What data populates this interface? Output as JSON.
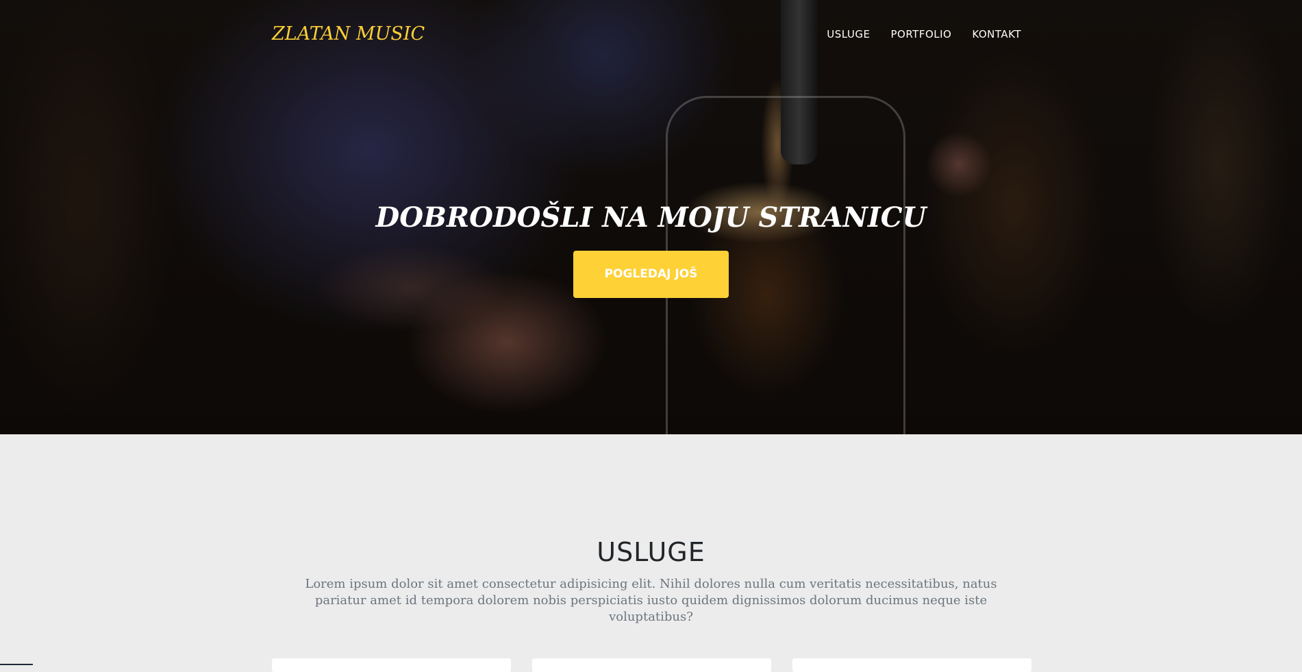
{
  "navbar": {
    "brand": "ZLATAN MUSIC",
    "links": [
      "USLUGE",
      "PORTFOLIO",
      "KONTAKT"
    ]
  },
  "hero": {
    "title": "DOBRODOŠLI NA MOJU STRANICU",
    "button_label": "POGLEDAJ JOŠ"
  },
  "services": {
    "heading": "USLUGE",
    "subheading": "Lorem ipsum dolor sit amet consectetur adipisicing elit. Nihil dolores nulla cum veritatis necessitatibus, natus pariatur amet id tempora dolorem nobis perspiciatis iusto quidem dignissimos dolorum ducimus neque iste voluptatibus?"
  },
  "colors": {
    "accent": "#fed136",
    "section_bg": "#ececec",
    "heading_text": "#212529",
    "muted_text": "#6c757d"
  }
}
